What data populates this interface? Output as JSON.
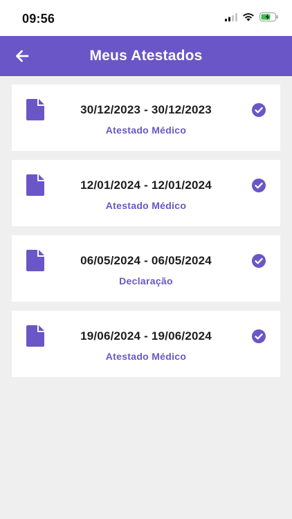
{
  "status_bar": {
    "time": "09:56"
  },
  "header": {
    "title": "Meus Atestados"
  },
  "colors": {
    "accent": "#6a56c6",
    "background": "#efefef",
    "card": "#ffffff",
    "battery": "#3bc24a"
  },
  "icons": {
    "back": "arrow-left-icon",
    "document": "document-icon",
    "status": "check-circle-icon"
  },
  "atestados": [
    {
      "dates": "30/12/2023 - 30/12/2023",
      "type": "Atestado Médico"
    },
    {
      "dates": "12/01/2024 - 12/01/2024",
      "type": "Atestado Médico"
    },
    {
      "dates": "06/05/2024 - 06/05/2024",
      "type": "Declaração"
    },
    {
      "dates": "19/06/2024 - 19/06/2024",
      "type": "Atestado Médico"
    }
  ]
}
